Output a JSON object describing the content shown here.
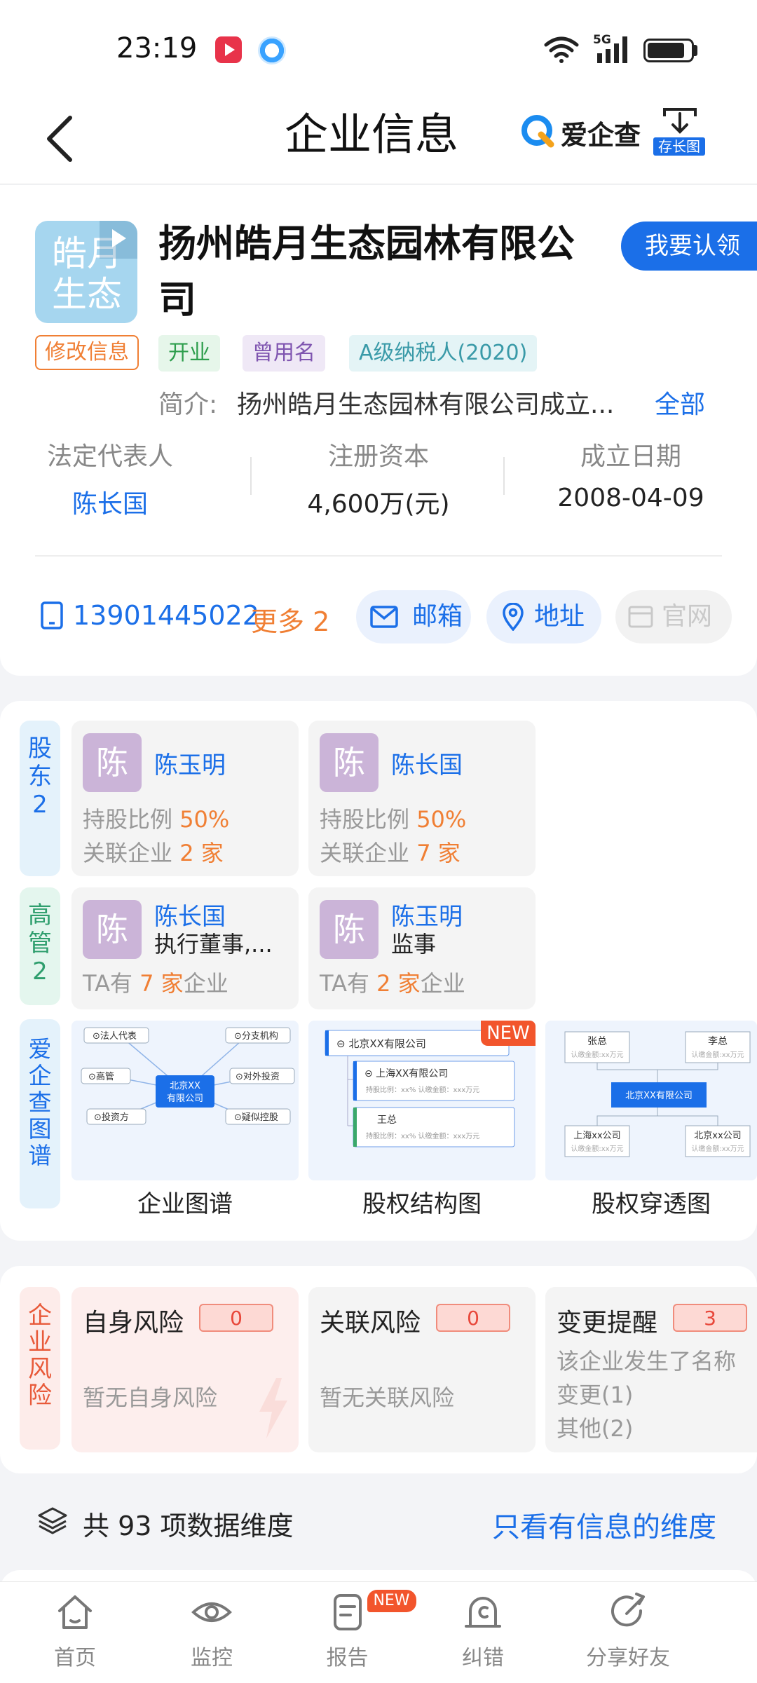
{
  "status_bar": {
    "time": "23:19"
  },
  "header": {
    "title": "企业信息",
    "brand": "爱企查",
    "save_label": "存长图"
  },
  "company": {
    "logo_text": "皓月\n生态",
    "name": "扬州皓月生态园林有限公司",
    "claim_label": "我要认领",
    "tags": {
      "edit": "修改信息",
      "status": "开业",
      "former_name": "曾用名",
      "tax": "A级纳税人(2020)"
    },
    "intro_label": "简介:",
    "intro_text": "扬州皓月生态园林有限公司成立...",
    "intro_all": "全部",
    "legal_rep_label": "法定代表人",
    "legal_rep": "陈长国",
    "capital_label": "注册资本",
    "capital": "4,600万(元)",
    "founded_label": "成立日期",
    "founded": "2008-04-09",
    "phone": "13901445022",
    "phone_more": "更多 2",
    "email_label": "邮箱",
    "address_label": "地址",
    "website_label": "官网"
  },
  "shareholders": {
    "side_label": "股东\n2",
    "items": [
      {
        "avatar": "陈",
        "name": "陈玉明",
        "ratio_label": "持股比例",
        "ratio": "50%",
        "related_label": "关联企业",
        "related": "2 家"
      },
      {
        "avatar": "陈",
        "name": "陈长国",
        "ratio_label": "持股比例",
        "ratio": "50%",
        "related_label": "关联企业",
        "related": "7 家"
      }
    ]
  },
  "executives": {
    "side_label": "高管\n2",
    "items": [
      {
        "avatar": "陈",
        "name": "陈长国",
        "role": "执行董事,...",
        "ta_prefix": "TA有",
        "count": "7 家",
        "ta_suffix": "企业"
      },
      {
        "avatar": "陈",
        "name": "陈玉明",
        "role": "监事",
        "ta_prefix": "TA有",
        "count": "2 家",
        "ta_suffix": "企业"
      }
    ]
  },
  "graphs": {
    "side_label": "爱企查图谱",
    "items": [
      {
        "caption": "企业图谱",
        "center": "北京XX\n有限公司",
        "nodes": [
          "法人代表",
          "分支机构",
          "高管",
          "对外投资",
          "投资方",
          "疑似控股"
        ]
      },
      {
        "caption": "股权结构图",
        "badge": "NEW",
        "top": "北京XX有限公司",
        "sub1": "上海XX有限公司",
        "sub1_detail": "持股比例：xx%    认缴金额：xxx万元",
        "sub2": "王总",
        "sub2_detail": "持股比例：xx%    认缴金额：xxx万元"
      },
      {
        "caption": "股权穿透图",
        "center": "北京XX有限公司",
        "p1": "张总",
        "p2": "李总",
        "c1": "上海xx公司",
        "c2": "北京xx公司",
        "amount": "认缴金额:xx万元"
      }
    ]
  },
  "risk": {
    "side_label": "企业风险",
    "items": [
      {
        "title": "自身风险",
        "count": "0",
        "desc": "暂无自身风险"
      },
      {
        "title": "关联风险",
        "count": "0",
        "desc": "暂无关联风险"
      },
      {
        "title": "变更提醒",
        "count": "3",
        "desc1": "该企业发生了名称",
        "desc2": "变更(1)",
        "desc3": "其他(2)"
      }
    ]
  },
  "dimensions": {
    "text": "共 93 项数据维度",
    "link": "只看有信息的维度"
  },
  "bottom_nav": {
    "items": [
      {
        "label": "首页",
        "icon": "home-icon"
      },
      {
        "label": "监控",
        "icon": "eye-icon"
      },
      {
        "label": "报告",
        "icon": "report-icon",
        "badge": "NEW"
      },
      {
        "label": "纠错",
        "icon": "correction-icon"
      },
      {
        "label": "分享好友",
        "icon": "share-icon"
      }
    ]
  },
  "colors": {
    "accent": "#1b6fe8",
    "orange": "#f07f34",
    "red": "#e8473a"
  }
}
